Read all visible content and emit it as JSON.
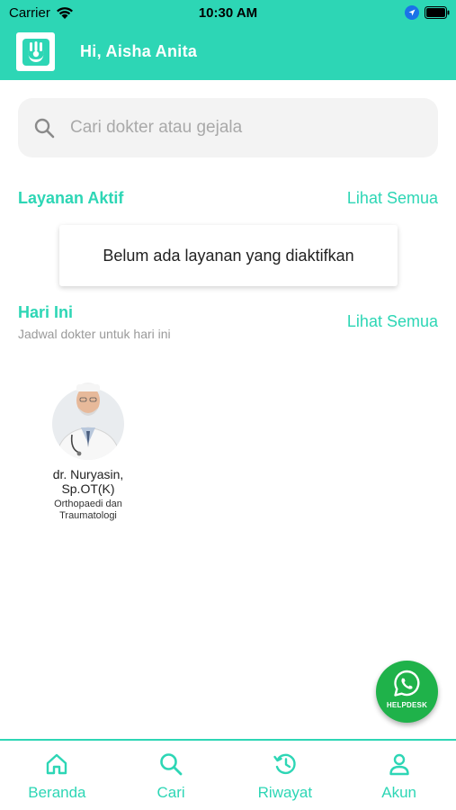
{
  "status_bar": {
    "carrier": "Carrier",
    "time": "10:30 AM"
  },
  "header": {
    "greeting": "Hi, Aisha Anita",
    "logo_icon": "hand-logo-icon"
  },
  "search": {
    "placeholder": "Cari dokter atau gejala"
  },
  "active_services": {
    "title": "Layanan Aktif",
    "see_all": "Lihat Semua",
    "empty_message": "Belum ada layanan yang diaktifkan"
  },
  "today": {
    "title": "Hari Ini",
    "subtitle": "Jadwal dokter untuk hari ini",
    "see_all": "Lihat Semua",
    "doctors": [
      {
        "name": "dr. Nuryasin, Sp.OT(K)",
        "specialty": "Orthopaedi dan Traumatologi"
      }
    ]
  },
  "helpdesk": {
    "label": "HELPDESK",
    "icon": "whatsapp-icon"
  },
  "bottom_nav": {
    "items": [
      {
        "label": "Beranda",
        "icon": "home-icon"
      },
      {
        "label": "Cari",
        "icon": "search-icon"
      },
      {
        "label": "Riwayat",
        "icon": "history-icon"
      },
      {
        "label": "Akun",
        "icon": "account-icon"
      }
    ]
  },
  "colors": {
    "primary": "#2dd6b5",
    "helpdesk": "#1fb24a",
    "background": "#ffffff"
  }
}
